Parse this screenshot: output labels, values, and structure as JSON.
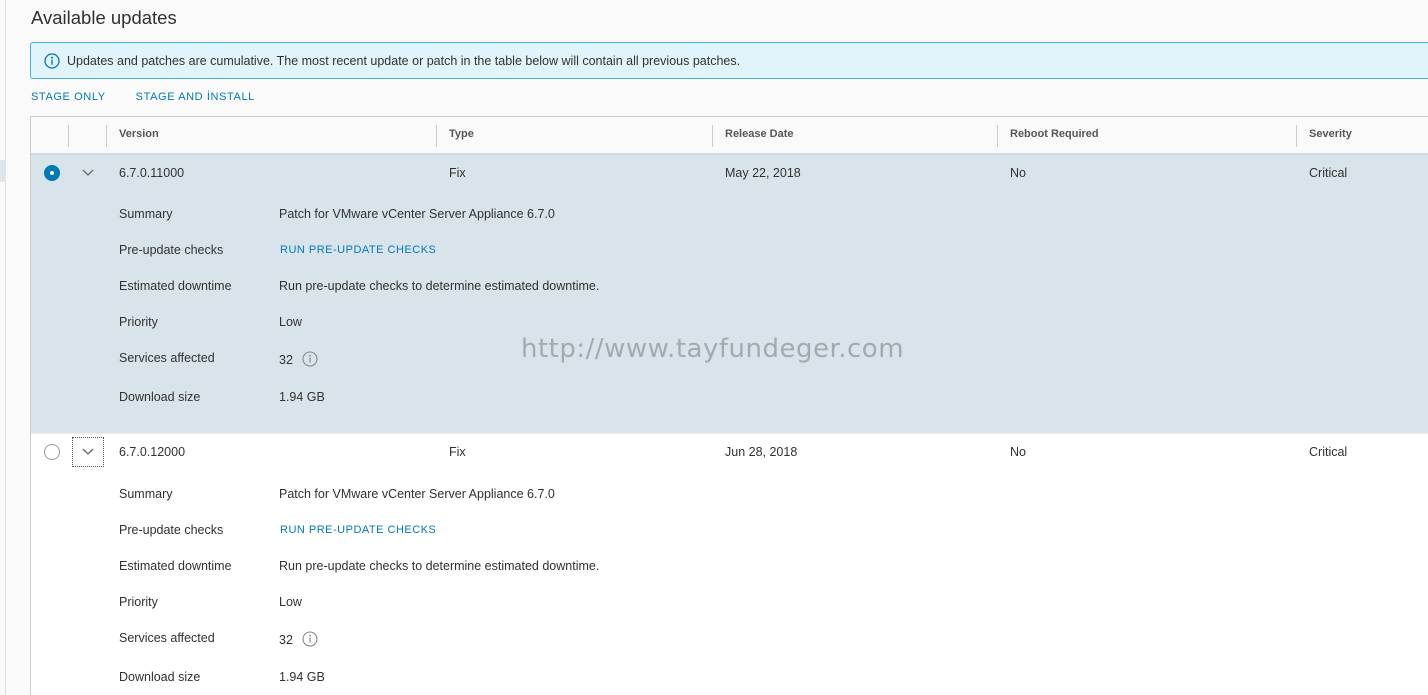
{
  "page": {
    "title": "Available updates"
  },
  "alert": {
    "icon": "info-circle-icon",
    "text": "Updates and patches are cumulative. The most recent update or patch in the table below will contain all previous patches."
  },
  "actions": {
    "stage_only": "STAGE ONLY",
    "stage_and_install": "STAGE AND İNSTALL"
  },
  "table": {
    "columns": [
      "Version",
      "Type",
      "Release Date",
      "Reboot Required",
      "Severity"
    ],
    "detail_labels": {
      "summary": "Summary",
      "pre_update_checks": "Pre-update checks",
      "estimated_downtime": "Estimated downtime",
      "priority": "Priority",
      "services_affected": "Services affected",
      "download_size": "Download size"
    },
    "rows": [
      {
        "selected": true,
        "version": "6.7.0.11000",
        "type": "Fix",
        "release_date": "May 22, 2018",
        "reboot_required": "No",
        "severity": "Critical",
        "summary": "Patch for VMware vCenter Server Appliance 6.7.0",
        "pre_update_checks_link": "RUN PRE-UPDATE CHECKS",
        "estimated_downtime": "Run pre-update checks to determine estimated downtime.",
        "priority": "Low",
        "services_affected": "32",
        "download_size": "1.94 GB"
      },
      {
        "selected": false,
        "version": "6.7.0.12000",
        "type": "Fix",
        "release_date": "Jun 28, 2018",
        "reboot_required": "No",
        "severity": "Critical",
        "summary": "Patch for VMware vCenter Server Appliance 6.7.0",
        "pre_update_checks_link": "RUN PRE-UPDATE CHECKS",
        "estimated_downtime": "Run pre-update checks to determine estimated downtime.",
        "priority": "Low",
        "services_affected": "32",
        "download_size": "1.94 GB"
      }
    ]
  },
  "watermark": "http://www.tayfundeger.com",
  "colors": {
    "accent": "#0079b8",
    "selected_row": "#d9e4ea",
    "alert_bg": "#e2f4fb",
    "alert_border": "#49afd9"
  }
}
